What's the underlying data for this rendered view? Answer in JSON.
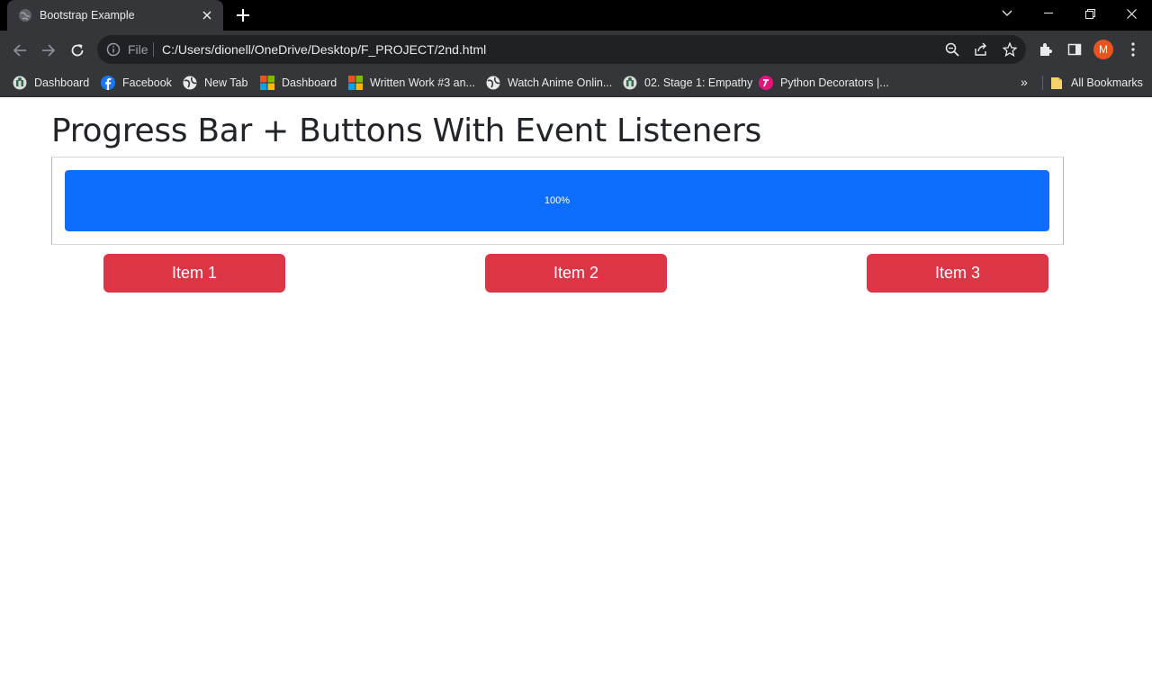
{
  "browser": {
    "tab": {
      "title": "Bootstrap Example"
    },
    "address": {
      "scheme_label": "File",
      "url": "C:/Users/dionell/OneDrive/Desktop/F_PROJECT/2nd.html"
    },
    "profile_initial": "M",
    "bookmarks": [
      {
        "label": "Dashboard",
        "icon": "moodle-icon"
      },
      {
        "label": "Facebook",
        "icon": "facebook-icon"
      },
      {
        "label": "New Tab",
        "icon": "globe-icon"
      },
      {
        "label": "Dashboard",
        "icon": "microsoft-icon"
      },
      {
        "label": "Written Work #3 an...",
        "icon": "microsoft-icon"
      },
      {
        "label": "Watch Anime Onlin...",
        "icon": "globe-icon"
      },
      {
        "label": "02. Stage 1: Empathy",
        "icon": "moodle-icon"
      },
      {
        "label": "Python Decorators |...",
        "icon": "pink-app-icon"
      }
    ],
    "all_bookmarks_label": "All Bookmarks",
    "overflow_label": "»"
  },
  "page": {
    "heading": "Progress Bar + Buttons With Event Listeners",
    "progress": {
      "value_percent": 100,
      "label": "100%"
    },
    "buttons": [
      {
        "label": "Item 1"
      },
      {
        "label": "Item 2"
      },
      {
        "label": "Item 3"
      }
    ]
  },
  "colors": {
    "progress_fill": "#0d6efd",
    "button_danger": "#dc3545",
    "chrome_dark": "#35363a",
    "titlebar": "#000000"
  }
}
